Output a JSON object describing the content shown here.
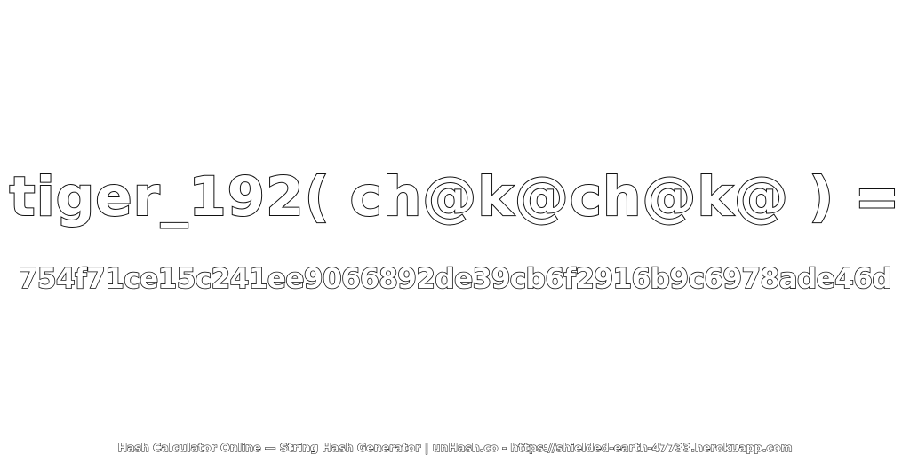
{
  "expression": "tiger_192( ch@k@ch@k@ ) =",
  "hash_value": "754f71ce15c241ee9066892de39cb6f2916b9c6978ade46d",
  "footer_text": "Hash Calculator Online — String Hash Generator | unHash.co - https://shielded-earth-47733.herokuapp.com",
  "colors": {
    "background": "#ffffff",
    "text_fill": "#ffffff",
    "text_outline": "#111111"
  }
}
